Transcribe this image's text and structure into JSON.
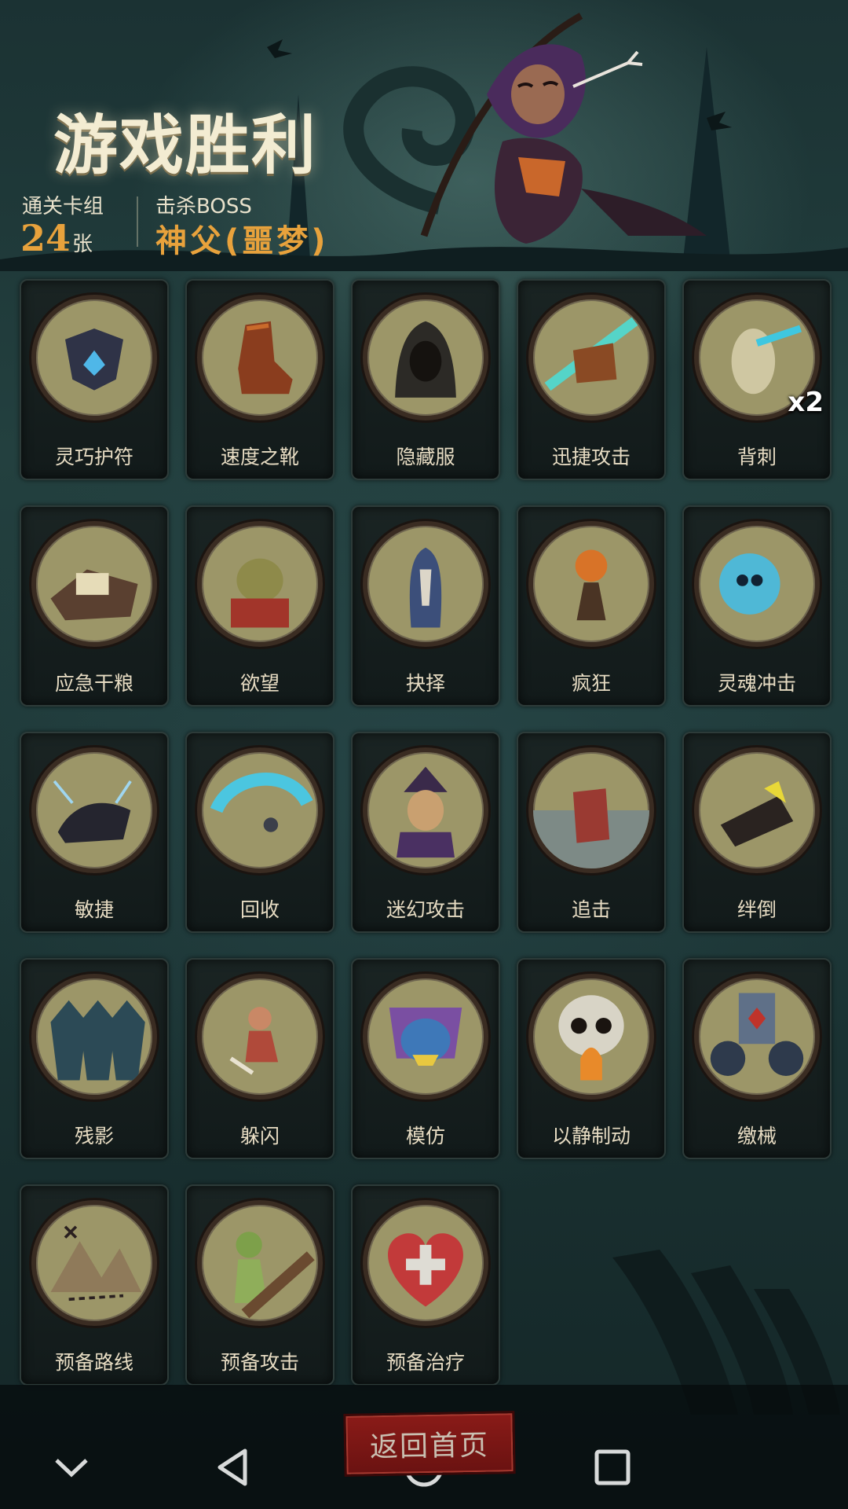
{
  "header": {
    "title": "游戏胜利",
    "deck_label": "通关卡组",
    "deck_count": "24",
    "deck_unit": "张",
    "boss_label": "击杀BOSS",
    "boss_name": "神父(噩梦)"
  },
  "cards": [
    {
      "label": "灵巧护符",
      "icon": "amulet-icon"
    },
    {
      "label": "速度之靴",
      "icon": "boot-icon"
    },
    {
      "label": "隐藏服",
      "icon": "hood-icon"
    },
    {
      "label": "迅捷攻击",
      "icon": "swift-strike-icon"
    },
    {
      "label": "背刺",
      "icon": "backstab-icon",
      "badge": "x2"
    },
    {
      "label": "应急干粮",
      "icon": "rations-icon"
    },
    {
      "label": "欲望",
      "icon": "greed-icon"
    },
    {
      "label": "抉择",
      "icon": "choice-icon"
    },
    {
      "label": "疯狂",
      "icon": "madness-icon"
    },
    {
      "label": "灵魂冲击",
      "icon": "soul-blast-icon"
    },
    {
      "label": "敏捷",
      "icon": "panther-icon"
    },
    {
      "label": "回收",
      "icon": "recycle-icon"
    },
    {
      "label": "迷幻攻击",
      "icon": "illusion-icon"
    },
    {
      "label": "追击",
      "icon": "pursuit-icon"
    },
    {
      "label": "绊倒",
      "icon": "trip-icon"
    },
    {
      "label": "残影",
      "icon": "afterimage-icon"
    },
    {
      "label": "躲闪",
      "icon": "dodge-icon"
    },
    {
      "label": "模仿",
      "icon": "mimic-icon"
    },
    {
      "label": "以静制动",
      "icon": "skull-icon"
    },
    {
      "label": "缴械",
      "icon": "disarm-icon"
    },
    {
      "label": "预备路线",
      "icon": "map-icon"
    },
    {
      "label": "预备攻击",
      "icon": "ready-attack-icon"
    },
    {
      "label": "预备治疗",
      "icon": "heart-heal-icon"
    }
  ],
  "actions": {
    "home_label": "返回首页"
  },
  "navbar": {
    "icons": [
      "chevron-down-icon",
      "back-triangle-icon",
      "home-circle-icon",
      "recent-square-icon"
    ]
  },
  "colors": {
    "accent": "#e8a23c",
    "medal": "#9c9668",
    "button": "#7a1614"
  }
}
